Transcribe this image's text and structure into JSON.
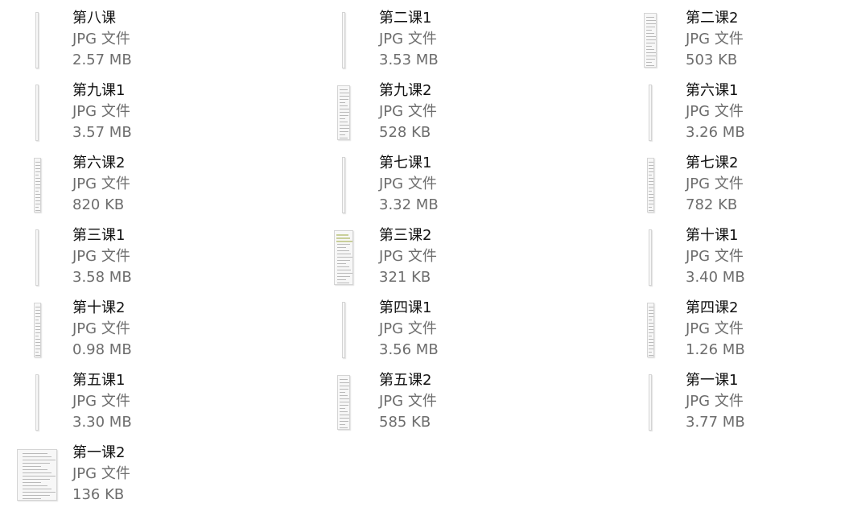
{
  "view": {
    "text_primary": "#111111",
    "text_secondary": "#6d6d6d",
    "background": "#ffffff"
  },
  "files": [
    {
      "name": "第八课",
      "type": "JPG 文件",
      "size": "2.57 MB",
      "thumb": "sliver"
    },
    {
      "name": "第二课1",
      "type": "JPG 文件",
      "size": "3.53 MB",
      "thumb": "sliver"
    },
    {
      "name": "第二课2",
      "type": "JPG 文件",
      "size": "503 KB",
      "thumb": "narrow"
    },
    {
      "name": "第九课1",
      "type": "JPG 文件",
      "size": "3.57 MB",
      "thumb": "sliver"
    },
    {
      "name": "第九课2",
      "type": "JPG 文件",
      "size": "528 KB",
      "thumb": "narrow"
    },
    {
      "name": "第六课1",
      "type": "JPG 文件",
      "size": "3.26 MB",
      "thumb": "sliver"
    },
    {
      "name": "第六课2",
      "type": "JPG 文件",
      "size": "820 KB",
      "thumb": "thin"
    },
    {
      "name": "第七课1",
      "type": "JPG 文件",
      "size": "3.32 MB",
      "thumb": "sliver"
    },
    {
      "name": "第七课2",
      "type": "JPG 文件",
      "size": "782 KB",
      "thumb": "thin"
    },
    {
      "name": "第三课1",
      "type": "JPG 文件",
      "size": "3.58 MB",
      "thumb": "sliver"
    },
    {
      "name": "第三课2",
      "type": "JPG 文件",
      "size": "321 KB",
      "thumb": "medium"
    },
    {
      "name": "第十课1",
      "type": "JPG 文件",
      "size": "3.40 MB",
      "thumb": "sliver"
    },
    {
      "name": "第十课2",
      "type": "JPG 文件",
      "size": "0.98 MB",
      "thumb": "thin"
    },
    {
      "name": "第四课1",
      "type": "JPG 文件",
      "size": "3.56 MB",
      "thumb": "sliver"
    },
    {
      "name": "第四课2",
      "type": "JPG 文件",
      "size": "1.26 MB",
      "thumb": "thin"
    },
    {
      "name": "第五课1",
      "type": "JPG 文件",
      "size": "3.30 MB",
      "thumb": "sliver"
    },
    {
      "name": "第五课2",
      "type": "JPG 文件",
      "size": "585 KB",
      "thumb": "narrow"
    },
    {
      "name": "第一课1",
      "type": "JPG 文件",
      "size": "3.77 MB",
      "thumb": "sliver"
    },
    {
      "name": "第一课2",
      "type": "JPG 文件",
      "size": "136 KB",
      "thumb": "wide"
    }
  ]
}
